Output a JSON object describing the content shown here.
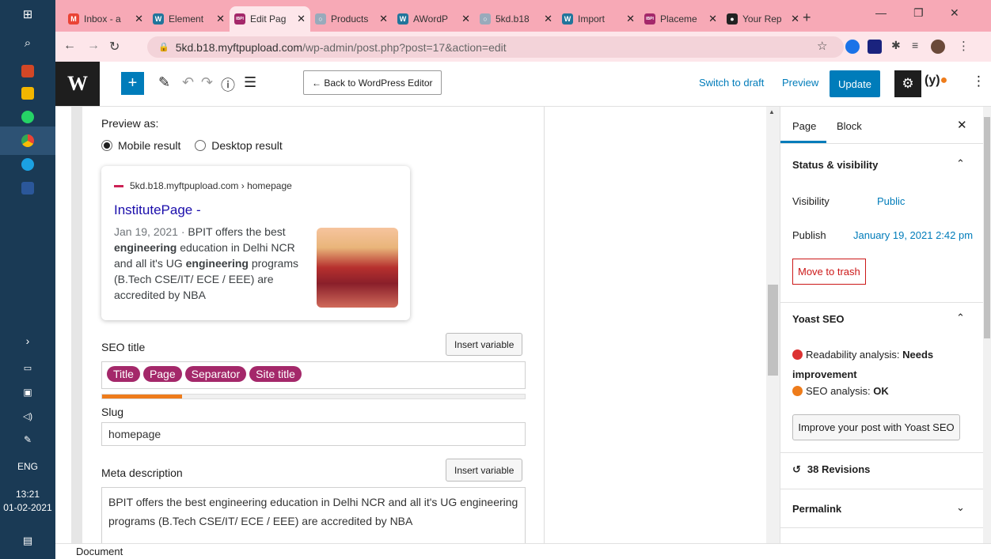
{
  "taskbar": {
    "items": [
      {
        "name": "windows-start",
        "color": "#ffffff"
      },
      {
        "name": "search",
        "color": "#ffffff"
      },
      {
        "name": "powerpoint",
        "color": "#d24726"
      },
      {
        "name": "file-explorer",
        "color": "#f2b600"
      },
      {
        "name": "whatsapp",
        "color": "#25d366"
      },
      {
        "name": "chrome",
        "color": "#e94235"
      },
      {
        "name": "edge",
        "color": "#1ba1e2"
      },
      {
        "name": "word",
        "color": "#2b579a"
      }
    ],
    "language": "ENG",
    "time": "13:21",
    "date": "01-02-2021"
  },
  "browser": {
    "tabs": [
      {
        "title": "Inbox - a",
        "favicon": "M",
        "color": "#ea4335"
      },
      {
        "title": "Element",
        "favicon": "W",
        "color": "#21759b"
      },
      {
        "title": "Edit Pag",
        "favicon": "IBPI",
        "color": "#a4286a"
      },
      {
        "title": "Products",
        "favicon": "○",
        "color": "#9ab"
      },
      {
        "title": "AWordP",
        "favicon": "W",
        "color": "#21759b"
      },
      {
        "title": "5kd.b18",
        "favicon": "○",
        "color": "#9ab"
      },
      {
        "title": "Import",
        "favicon": "W",
        "color": "#21759b"
      },
      {
        "title": "Placeme",
        "favicon": "IBPI",
        "color": "#a4286a"
      },
      {
        "title": "Your Rep",
        "favicon": "●",
        "color": "#222"
      }
    ],
    "active_tab_index": 2,
    "url_host": "5kd.b18.myftpupload.com",
    "url_path": "/wp-admin/post.php?post=17&action=edit"
  },
  "header": {
    "back_button": "← Back to WordPress Editor",
    "switch_draft": "Switch to draft",
    "preview": "Preview",
    "update": "Update"
  },
  "seo_panel": {
    "preview_as": "Preview as:",
    "mobile_result": "Mobile result",
    "desktop_result": "Desktop result",
    "snippet": {
      "url": "5kd.b18.myftpupload.com › homepage",
      "title": "InstitutePage -",
      "date": "Jan 19, 2021 · ",
      "desc_parts": [
        "BPIT offers the best ",
        "engineering",
        " education in Delhi NCR and all it's UG ",
        "engineering",
        " programs (B.Tech CSE/IT/ ECE / EEE) are accredited by NBA"
      ]
    },
    "seo_title_label": "SEO title",
    "insert_variable": "Insert variable",
    "title_pills": [
      "Title",
      "Page",
      "Separator",
      "Site title"
    ],
    "title_progress": 0.19,
    "slug_label": "Slug",
    "slug_value": "homepage",
    "meta_label": "Meta description",
    "meta_value": "BPIT offers the best engineering education in Delhi NCR and all it's UG engineering programs (B.Tech CSE/IT/ ECE / EEE) are accredited by NBA"
  },
  "sidebar": {
    "tab_page": "Page",
    "tab_block": "Block",
    "status_heading": "Status & visibility",
    "visibility_label": "Visibility",
    "visibility_value": "Public",
    "publish_label": "Publish",
    "publish_value": "January 19, 2021 2:42 pm",
    "trash": "Move to trash",
    "yoast_heading": "Yoast SEO",
    "readability_label": "Readability analysis: ",
    "readability_value": "Needs improvement",
    "seo_label": "SEO analysis: ",
    "seo_value": "OK",
    "improve_button": "Improve your post with Yoast SEO",
    "revisions": "38 Revisions",
    "permalink": "Permalink"
  },
  "status_bar": "Document"
}
